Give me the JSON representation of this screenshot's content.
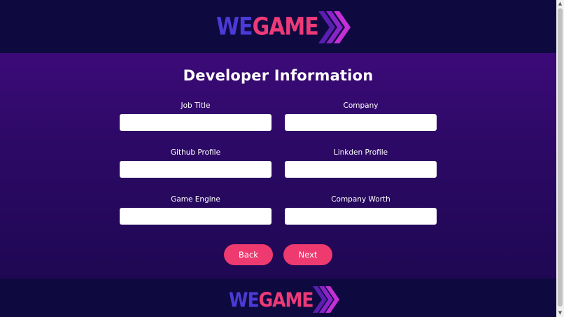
{
  "logo": {
    "part1": "WE",
    "part2": "GAME"
  },
  "form": {
    "title": "Developer Information",
    "fields": [
      {
        "label": "Job Title",
        "value": "",
        "placeholder": ""
      },
      {
        "label": "Company",
        "value": "",
        "placeholder": ""
      },
      {
        "label": "Github Profile",
        "value": "",
        "placeholder": ""
      },
      {
        "label": "Linkden Profile",
        "value": "",
        "placeholder": ""
      },
      {
        "label": "Game Engine",
        "value": "",
        "placeholder": ""
      },
      {
        "label": "Company Worth",
        "value": "",
        "placeholder": ""
      }
    ],
    "back_label": "Back",
    "next_label": "Next"
  },
  "colors": {
    "header_bg": "#0e0a40",
    "main_gradient_top": "#3c0a78",
    "main_gradient_bottom": "#1f0853",
    "accent": "#ee3a6e",
    "logo_blue": "#4a3bd6",
    "logo_pink": "#ee3a78",
    "arrow_purple": "#9b27c9"
  },
  "icons": {
    "logo_arrows": "chevron-arrows-icon",
    "scroll_up": "scroll-up-arrow-icon",
    "scroll_down": "scroll-down-arrow-icon"
  }
}
